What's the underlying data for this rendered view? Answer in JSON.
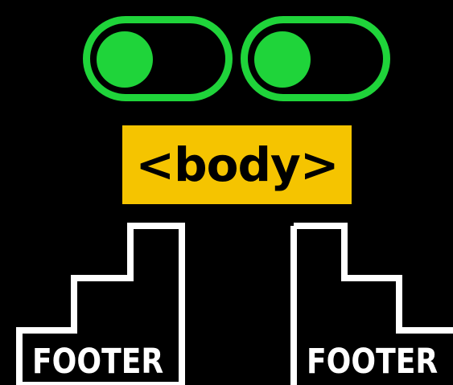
{
  "toggles": [
    {
      "name": "left",
      "state": "on"
    },
    {
      "name": "right",
      "state": "on"
    }
  ],
  "body_tag": {
    "label": "<body>"
  },
  "footers": [
    {
      "label": "FOOTER"
    },
    {
      "label": "FOOTER"
    }
  ],
  "colors": {
    "background": "#000000",
    "toggle": "#1fd43a",
    "tag_fill": "#f5c400",
    "tag_text": "#000000",
    "footer_outline": "#ffffff",
    "footer_text": "#ffffff"
  }
}
